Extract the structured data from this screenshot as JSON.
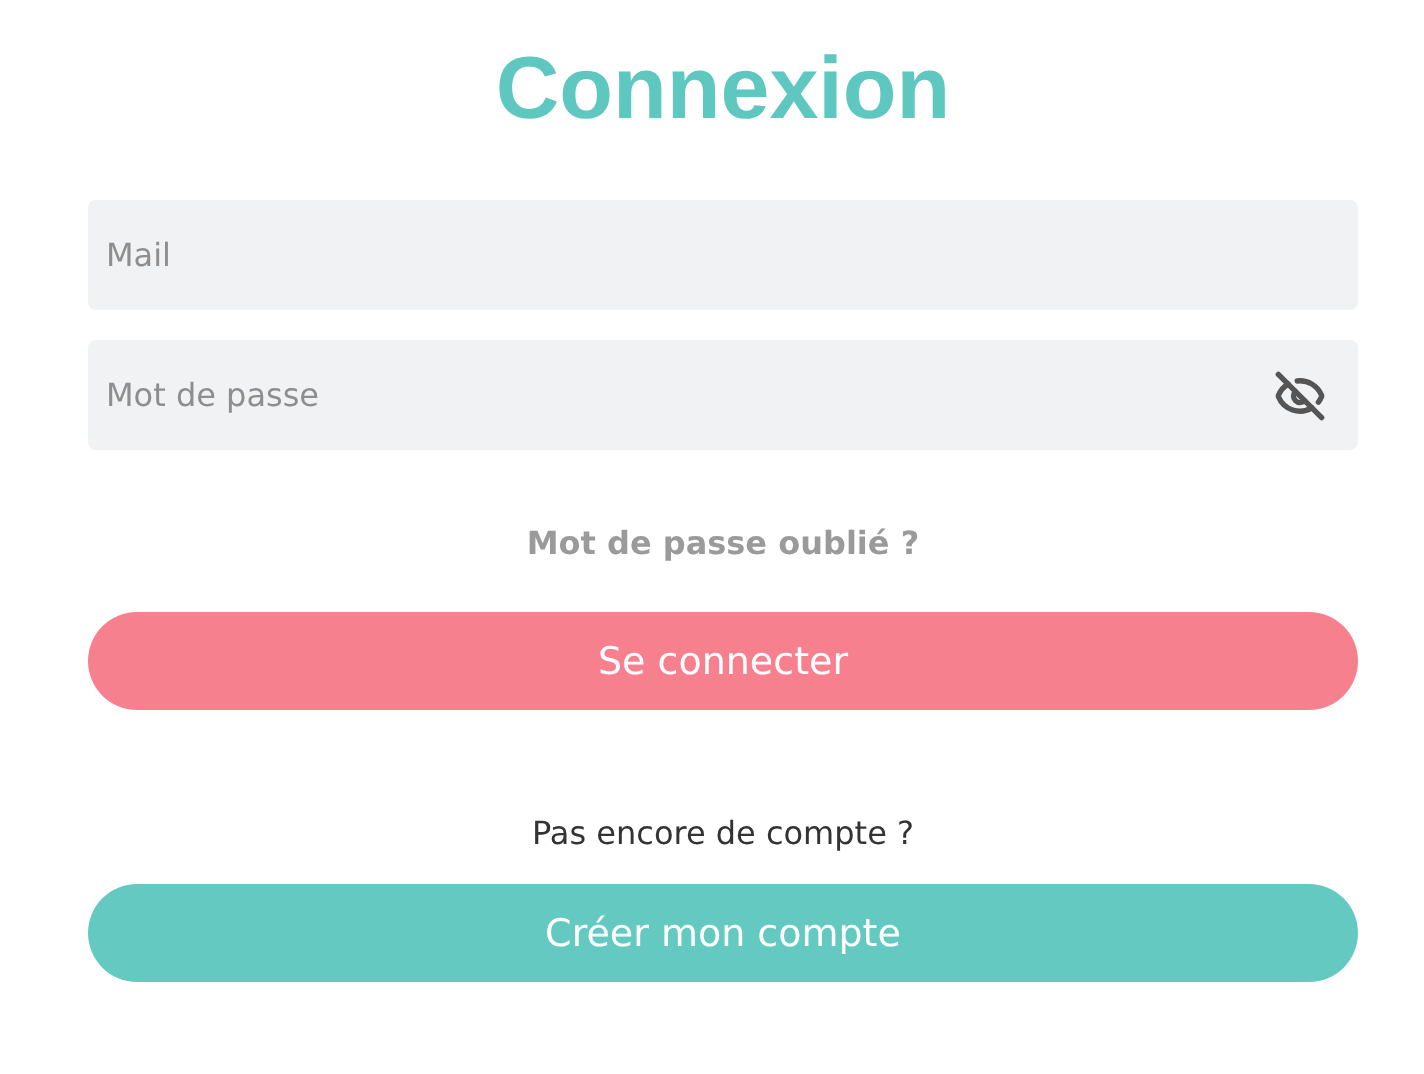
{
  "title": "Connexion",
  "fields": [
    {
      "placeholder": "Mail",
      "kind": "text"
    },
    {
      "placeholder": "Mot de passe",
      "kind": "password"
    }
  ],
  "forgot_link": "Mot de passe oublié ?",
  "login_button": "Se connecter",
  "signup_prompt": "Pas encore de compte ?",
  "signup_button": "Créer mon compte"
}
